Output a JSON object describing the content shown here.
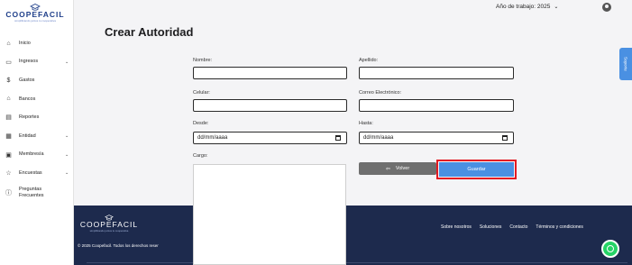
{
  "sidebar": {
    "brand": "COOPEFACIL",
    "tagline": "simplificando juntos tu cooperativa",
    "items": [
      {
        "label": "Inicio",
        "icon": "home-icon",
        "chevron": ""
      },
      {
        "label": "Ingresos",
        "icon": "money-icon",
        "chevron": "⌄"
      },
      {
        "label": "Gastos",
        "icon": "dollar-icon",
        "chevron": ""
      },
      {
        "label": "Bancos",
        "icon": "bank-icon",
        "chevron": ""
      },
      {
        "label": "Reportes",
        "icon": "report-icon",
        "chevron": ""
      },
      {
        "label": "Entidad",
        "icon": "building-icon",
        "chevron": "⌄"
      },
      {
        "label": "Membresía",
        "icon": "calendar-icon",
        "chevron": "⌄"
      },
      {
        "label": "Encuestas",
        "icon": "star-icon",
        "chevron": "⌄"
      },
      {
        "label": "Preguntas Frecuentes",
        "icon": "help-icon",
        "chevron": ""
      }
    ]
  },
  "topbar": {
    "year_label": "Año de trabajo: 2025",
    "year_caret": "⌄"
  },
  "page": {
    "title": "Crear Autoridad"
  },
  "soporte": {
    "label": "Soporte"
  },
  "form": {
    "nombre_label": "Nombre:",
    "apellido_label": "Apellido:",
    "celular_label": "Celular:",
    "correo_label": "Correo Electrónico:",
    "desde_label": "Desde:",
    "desde_value": "dd/mm/aaaa",
    "hasta_label": "Hasta:",
    "hasta_value": "dd/mm/aaaa",
    "cargo_label": "Cargo:"
  },
  "buttons": {
    "volver_label": "Volver",
    "guardar_label": "Guardar"
  },
  "footer": {
    "brand": "COOPEFACIL",
    "tagline": "simplificando juntos tu cooperativa",
    "copyright": "© 2025 Coopefacil. Todos los derechos reser",
    "links": [
      "Sobre nosotros",
      "Soluciones",
      "Contacto",
      "Términos y condiciones"
    ]
  },
  "colors": {
    "accent": "#4a90e2",
    "highlight": "#e31b23",
    "footer_bg": "#1d2a4d",
    "whatsapp": "#25d366"
  }
}
